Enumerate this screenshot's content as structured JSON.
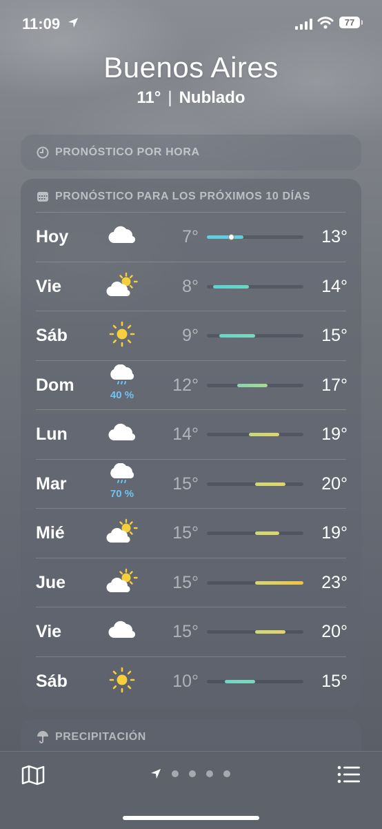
{
  "status_bar": {
    "time": "11:09",
    "battery": "77"
  },
  "location": {
    "city": "Buenos Aires",
    "temperature": "11°",
    "separator": "|",
    "condition": "Nublado"
  },
  "hourly_card": {
    "header": "PRONÓSTICO POR HORA",
    "icon": "clock-icon"
  },
  "ten_day_card": {
    "header": "PRONÓSTICO PARA LOS PRÓXIMOS 10 DÍAS",
    "icon": "calendar-icon",
    "range_min": 7,
    "range_max": 23,
    "current_temp": 11,
    "days": [
      {
        "day": "Hoy",
        "icon": "cloud-icon",
        "precip": "",
        "low": "7°",
        "high": "13°",
        "low_val": 7,
        "high_val": 13,
        "color_start": "#5fd0e0",
        "color_end": "#5fd0e0",
        "current": true
      },
      {
        "day": "Vie",
        "icon": "partly-sunny-icon",
        "precip": "",
        "low": "8°",
        "high": "14°",
        "low_val": 8,
        "high_val": 14,
        "color_start": "#5fd0d0",
        "color_end": "#6ad6c4"
      },
      {
        "day": "Sáb",
        "icon": "sun-icon",
        "precip": "",
        "low": "9°",
        "high": "15°",
        "low_val": 9,
        "high_val": 15,
        "color_start": "#68d4c8",
        "color_end": "#7ad8bc"
      },
      {
        "day": "Dom",
        "icon": "rain-icon",
        "precip": "40 %",
        "low": "12°",
        "high": "17°",
        "low_val": 12,
        "high_val": 17,
        "color_start": "#86d6ac",
        "color_end": "#a8d890"
      },
      {
        "day": "Lun",
        "icon": "cloud-icon",
        "precip": "",
        "low": "14°",
        "high": "19°",
        "low_val": 14,
        "high_val": 19,
        "color_start": "#c8d87a",
        "color_end": "#dcd66c"
      },
      {
        "day": "Mar",
        "icon": "rain-icon",
        "precip": "70 %",
        "low": "15°",
        "high": "20°",
        "low_val": 15,
        "high_val": 20,
        "color_start": "#d2d876",
        "color_end": "#e2d468"
      },
      {
        "day": "Mié",
        "icon": "partly-sunny-icon",
        "precip": "",
        "low": "15°",
        "high": "19°",
        "low_val": 15,
        "high_val": 19,
        "color_start": "#d2d876",
        "color_end": "#dcd66c"
      },
      {
        "day": "Jue",
        "icon": "partly-sunny-icon",
        "precip": "",
        "low": "15°",
        "high": "23°",
        "low_val": 15,
        "high_val": 23,
        "color_start": "#d6d870",
        "color_end": "#f0c440"
      },
      {
        "day": "Vie",
        "icon": "cloud-icon",
        "precip": "",
        "low": "15°",
        "high": "20°",
        "low_val": 15,
        "high_val": 20,
        "color_start": "#d2d876",
        "color_end": "#e2d468"
      },
      {
        "day": "Sáb",
        "icon": "sun-icon",
        "precip": "",
        "low": "10°",
        "high": "15°",
        "low_val": 10,
        "high_val": 15,
        "color_start": "#70d4c6",
        "color_end": "#80d8b8"
      }
    ]
  },
  "precip_card": {
    "header": "PRECIPITACIÓN",
    "icon": "umbrella-icon"
  },
  "tab_bar": {
    "left": "map-icon",
    "right": "list-icon",
    "page_count": 4,
    "current_page": 0
  }
}
